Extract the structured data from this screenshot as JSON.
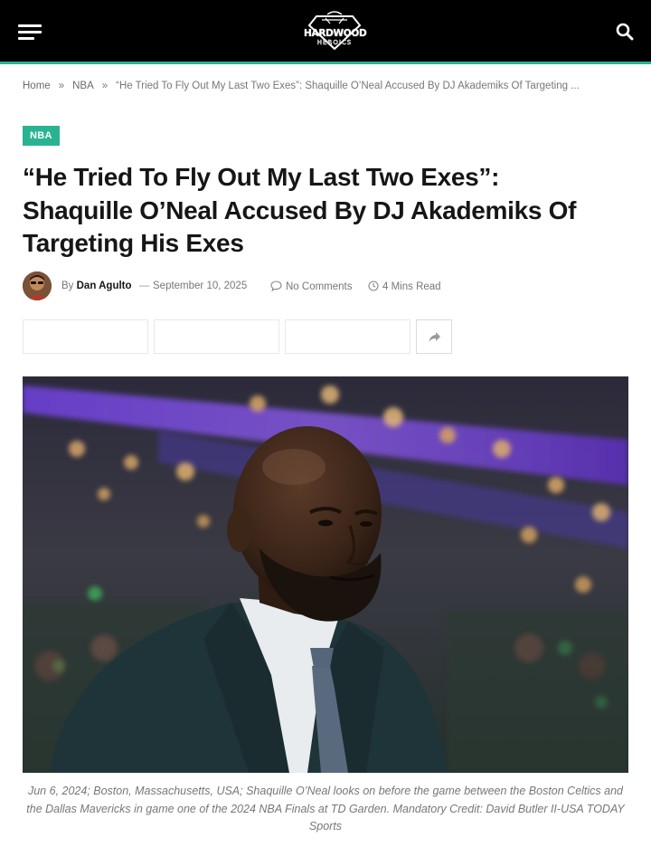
{
  "header": {
    "logo_line1": "HARDWOOD",
    "logo_line2": "HEROICS",
    "menu_icon": "hamburger-icon",
    "search_icon": "search-icon",
    "accent_color": "#2ab391"
  },
  "breadcrumb": {
    "items": [
      "Home",
      "NBA"
    ],
    "separator": "»",
    "current": "“He Tried To Fly Out My Last Two Exes”: Shaquille O’Neal Accused By DJ Akademiks Of Targeting ..."
  },
  "article": {
    "category": "NBA",
    "title_lines": [
      "“He Tried To Fly Out My Last Two Exes”:",
      "Shaquille O’Neal Accused By DJ Akademiks Of",
      "Targeting His Exes"
    ],
    "meta": {
      "by": "By",
      "author": "Dan Agulto",
      "dash": "—",
      "date": "September 10, 2025",
      "comments": "No Comments",
      "read_time": "4 Mins Read",
      "comment_icon": "comment-icon",
      "clock_icon": "clock-icon"
    },
    "share": {
      "more_icon": "share-arrow-icon"
    },
    "caption": "Jun 6, 2024; Boston, Massachusetts, USA; Shaquille O’Neal looks on before the game between the Boston Celtics and the Dallas Mavericks in game one of the 2024 NBA Finals at TD Garden. Mandatory Credit: David Butler II-USA TODAY Sports"
  }
}
